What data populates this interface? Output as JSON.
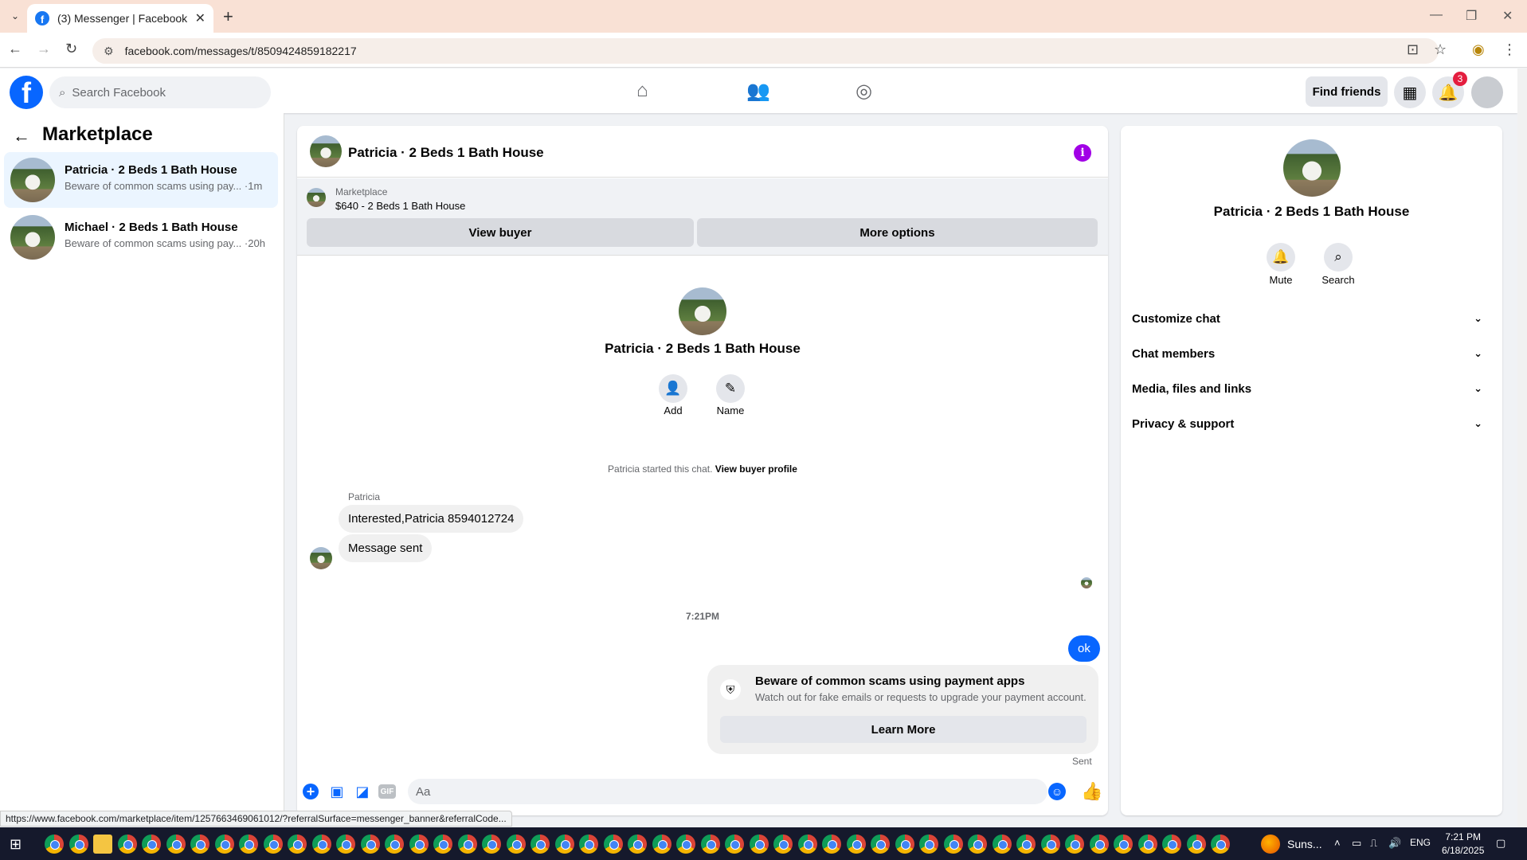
{
  "browser": {
    "tab_title": "(3) Messenger | Facebook",
    "tab_close": "✕",
    "new_tab": "+",
    "url": "facebook.com/messages/t/8509424859182217",
    "minimize": "—",
    "restore": "❐",
    "close": "✕"
  },
  "facebook": {
    "search_placeholder": "Search Facebook",
    "find_friends": "Find friends",
    "notification_count": "3"
  },
  "sidebar": {
    "title": "Marketplace",
    "conversations": [
      {
        "name": "Patricia · 2 Beds 1 Bath House",
        "preview": "Beware of common scams using pay... ·1m",
        "active": true
      },
      {
        "name": "Michael · 2 Beds 1 Bath House",
        "preview": "Beware of common scams using pay... ·20h",
        "active": false
      }
    ]
  },
  "chat": {
    "header_name": "Patricia · 2 Beds 1 Bath House",
    "marketplace_label": "Marketplace",
    "listing": "$640 - 2 Beds 1 Bath House",
    "view_buyer": "View buyer",
    "more_options": "More options",
    "center_name": "Patricia · 2 Beds 1 Bath House",
    "add_label": "Add",
    "name_label": "Name",
    "started_text": "Patricia started this chat.",
    "view_buyer_profile": "View buyer profile",
    "sender": "Patricia",
    "messages_in": [
      "Interested,Patricia 8594012724",
      "Message sent"
    ],
    "timestamp": "7:21PM",
    "message_out": "ok",
    "scam_title": "Beware of common scams using payment apps",
    "scam_subtitle": "Watch out for fake emails or requests to upgrade your payment account.",
    "learn_more": "Learn More",
    "sent_status": "Sent",
    "composer_placeholder": "Aa",
    "gif_label": "GIF"
  },
  "details": {
    "name": "Patricia · 2 Beds 1 Bath House",
    "mute": "Mute",
    "search": "Search",
    "sections": [
      "Customize chat",
      "Chat members",
      "Media, files and links",
      "Privacy & support"
    ]
  },
  "status_url": "https://www.facebook.com/marketplace/item/1257663469061012/?referralSurface=messenger_banner&referralCode...",
  "taskbar": {
    "weather": "Suns...",
    "language": "ENG",
    "time": "7:21 PM",
    "date": "6/18/2025"
  },
  "colors": {
    "brand_blue": "#0866ff",
    "info_purple": "#a100e6",
    "badge_red": "#e41e3f",
    "tab_strip": "#f9e1d5"
  }
}
